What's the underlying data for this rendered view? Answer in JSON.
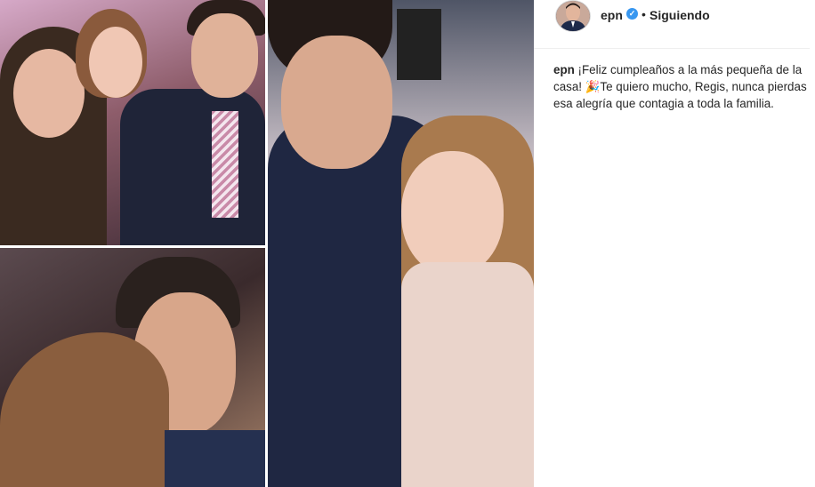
{
  "post": {
    "image_alt": "Collage de fotos familiares"
  },
  "header": {
    "username": "epn",
    "verified_icon": "verified-badge-icon",
    "separator": "•",
    "follow_status": "Siguiendo"
  },
  "caption": {
    "username": "epn",
    "text": "¡Feliz cumpleaños a la más pequeña de la casa! 🎉Te quiero mucho, Regis, nunca pierdas esa alegría que contagia a toda la familia."
  },
  "colors": {
    "verified": "#3897f0",
    "text": "#262626"
  }
}
